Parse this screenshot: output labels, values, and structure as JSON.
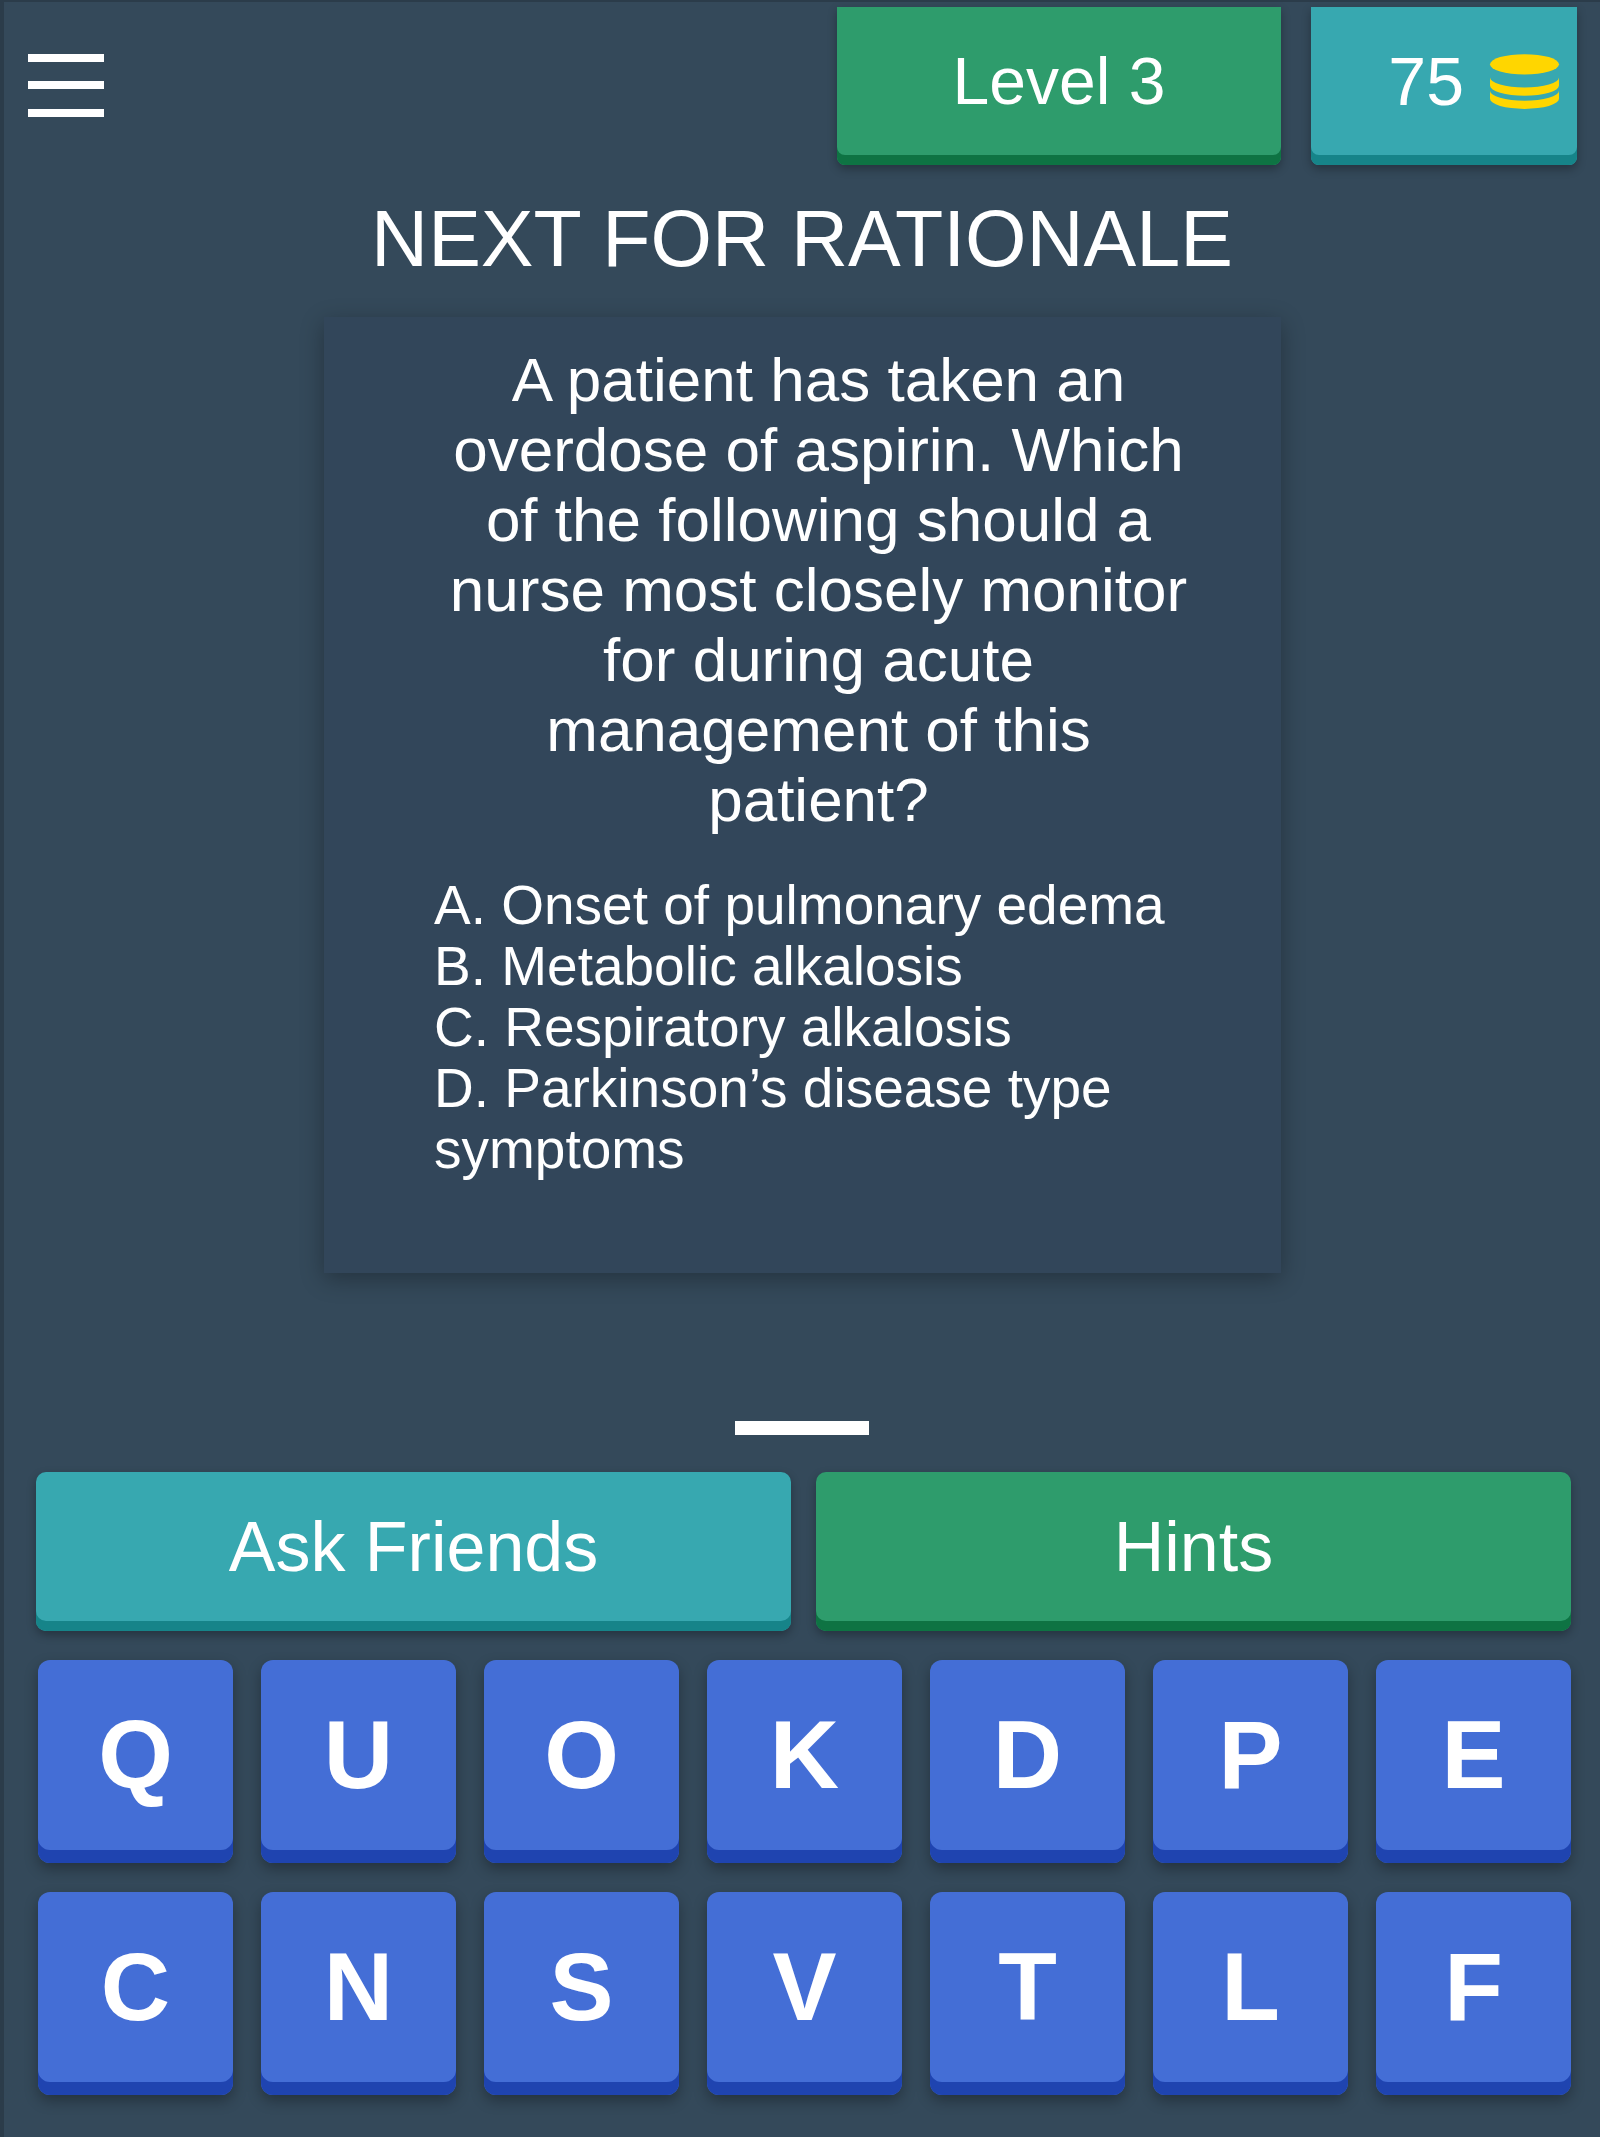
{
  "top_bar": {
    "level": "Level 3",
    "coins": "75"
  },
  "title": "NEXT FOR RATIONALE",
  "question": {
    "text": "A patient has taken an overdose of aspirin. Which of the following should a nurse most closely monitor for during acute management of this patient?",
    "options": [
      "A. Onset of pulmonary edema",
      "B. Metabolic alkalosis",
      "C. Respiratory alkalosis",
      "D. Parkinson’s disease type symptoms"
    ]
  },
  "answer_slots": [
    {
      "filled": false
    }
  ],
  "actions": [
    {
      "kind": "friends",
      "label": "Ask Friends"
    },
    {
      "kind": "hints",
      "label": "Hints"
    }
  ],
  "keyboard": {
    "rows": [
      [
        "Q",
        "U",
        "O",
        "K",
        "D",
        "P",
        "E"
      ],
      [
        "C",
        "N",
        "S",
        "V",
        "T",
        "L",
        "F"
      ]
    ]
  }
}
